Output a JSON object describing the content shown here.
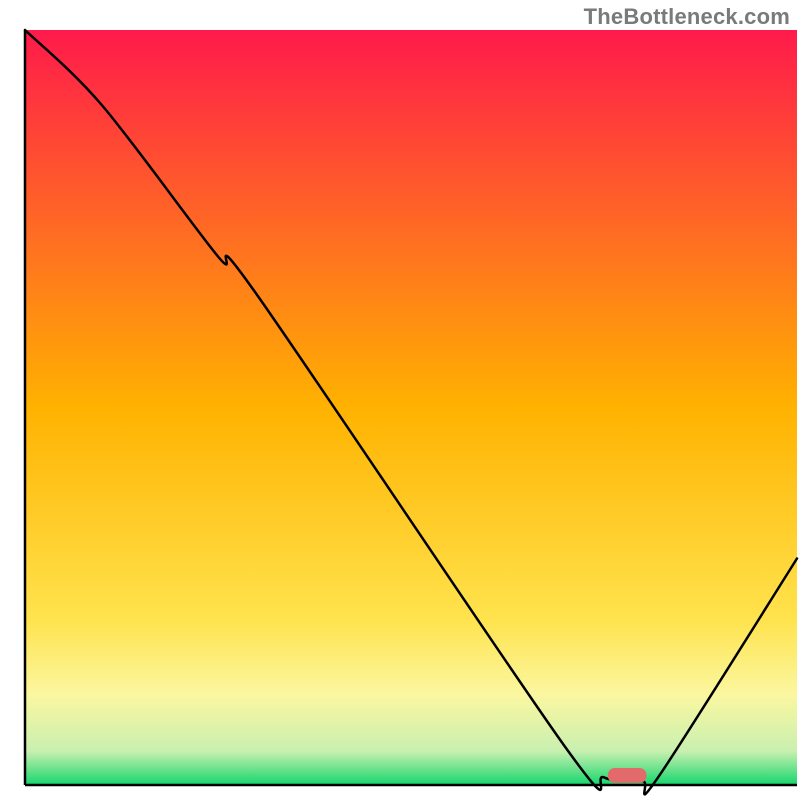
{
  "watermark": "TheBottleneck.com",
  "chart_data": {
    "type": "line",
    "title": "",
    "xlabel": "",
    "ylabel": "",
    "xlim": [
      0,
      100
    ],
    "ylim": [
      0,
      100
    ],
    "grid": false,
    "axes_visible": {
      "left": true,
      "bottom": true,
      "top": false,
      "right": false
    },
    "background_gradient": {
      "stops": [
        {
          "offset": 0.0,
          "color": "#ff1a4b"
        },
        {
          "offset": 0.5,
          "color": "#ffb200"
        },
        {
          "offset": 0.78,
          "color": "#ffe34d"
        },
        {
          "offset": 0.88,
          "color": "#fbf7a0"
        },
        {
          "offset": 0.955,
          "color": "#c9f0b0"
        },
        {
          "offset": 1.0,
          "color": "#16d66e"
        }
      ]
    },
    "series": [
      {
        "name": "bottleneck-curve",
        "color": "#000000",
        "x": [
          0,
          10,
          25,
          30,
          70,
          75,
          80,
          82,
          100
        ],
        "y": [
          100,
          90,
          70,
          65,
          5,
          1,
          0.5,
          1,
          30
        ]
      }
    ],
    "marker": {
      "name": "optimal-point",
      "shape": "rounded-bar",
      "x_center": 78,
      "width_pct": 5,
      "color": "#e26a6a"
    }
  }
}
